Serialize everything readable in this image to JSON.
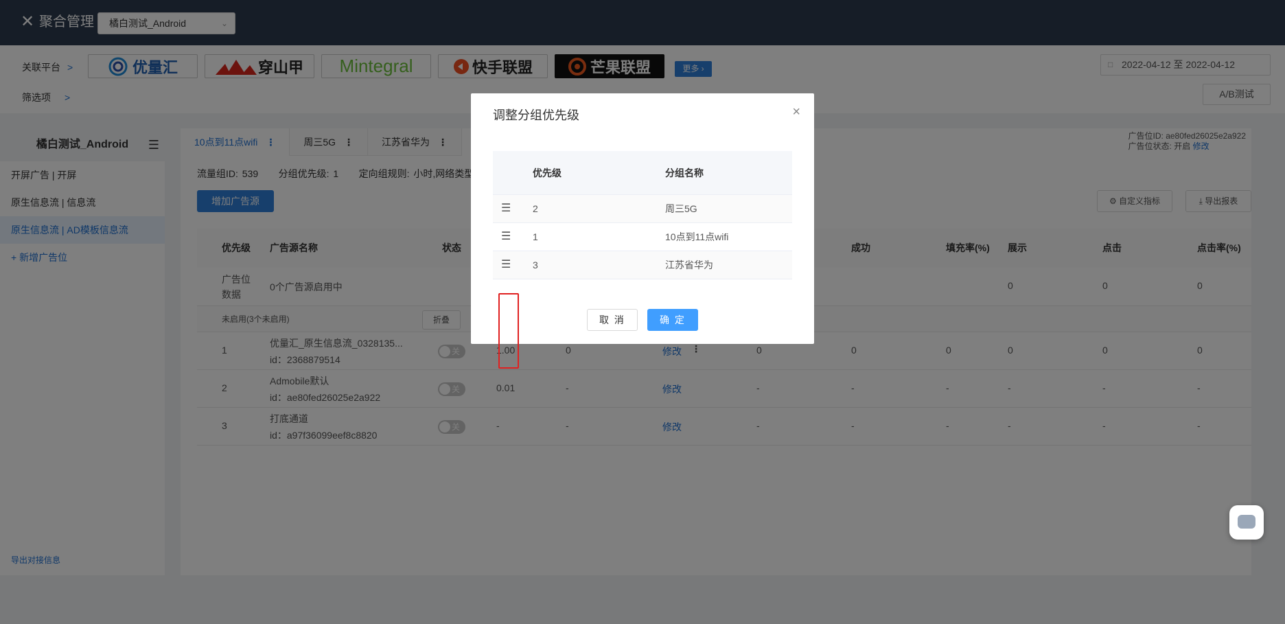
{
  "topbar": {
    "close": "✕",
    "title": "聚合管理",
    "app_select": "橘白测试_Android"
  },
  "platforms": {
    "label": "关联平台",
    "filter_label": "筛选项",
    "items": [
      "优量汇",
      "穿山甲",
      "Mintegral",
      "快手联盟",
      "芒果联盟"
    ],
    "more": "更多 ›",
    "date_start": "2022-04-12",
    "date_sep": "至",
    "date_end": "2022-04-12",
    "ab_test": "A/B测试"
  },
  "sidebar": {
    "title": "橘白测试_Android",
    "items": [
      "开屏广告 | 开屏",
      "原生信息流 | 信息流",
      "原生信息流 | AD模板信息流"
    ],
    "add": "+ 新增广告位",
    "export": "导出对接信息"
  },
  "main": {
    "tabs": [
      "10点到11点wifi",
      "周三5G",
      "江苏省华为"
    ],
    "ad_id_label": "广告位ID:",
    "ad_id": "ae80fed26025e2a922",
    "ad_status_label": "广告位状态:",
    "ad_status": "开启",
    "ad_status_edit": "修改",
    "flow_id": "流量组ID: 539",
    "group_priority": "分组优先级: 1",
    "targeting": "定向组规则: 小时,网络类型",
    "add_source": "增加广告源",
    "custom_metric": "⚙ 自定义指标",
    "export_report": "⤓ 导出报表",
    "headers": [
      "优先级",
      "广告源名称",
      "状态",
      "成功",
      "填充率(%)",
      "展示",
      "点击",
      "点击率(%)"
    ],
    "summary_label": "广告位数据",
    "summary_text": "0个广告源启用中",
    "summary_values": [
      "0",
      "0",
      "0"
    ],
    "disabled_text": "未启用(3个未启用)",
    "fold": "折叠",
    "toggle_off": "关",
    "edit": "修改",
    "rows": [
      {
        "priority": "1",
        "name": "优量汇_原生信息流_0328135...",
        "id": "id：2368879514",
        "price": "1.00",
        "c2": "0",
        "vals": [
          "0",
          "0",
          "0",
          "0",
          "0",
          "0"
        ]
      },
      {
        "priority": "2",
        "name": "Admobile默认",
        "id": "id：ae80fed26025e2a922",
        "price": "0.01",
        "c2": "-",
        "vals": [
          "-",
          "-",
          "-",
          "-",
          "-",
          "-"
        ]
      },
      {
        "priority": "3",
        "name": "打底通道",
        "id": "id：a97f36099eef8c8820",
        "price": "-",
        "c2": "-",
        "vals": [
          "-",
          "-",
          "-",
          "-",
          "-",
          "-"
        ]
      }
    ]
  },
  "modal": {
    "title": "调整分组优先级",
    "close": "×",
    "col_priority": "优先级",
    "col_name": "分组名称",
    "rows": [
      {
        "priority": "2",
        "name": "周三5G"
      },
      {
        "priority": "1",
        "name": "10点到11点wifi"
      },
      {
        "priority": "3",
        "name": "江苏省华为"
      }
    ],
    "cancel": "取 消",
    "confirm": "确 定"
  },
  "colors": {
    "accent": "#2f7fd8",
    "header_bg": "#2c3a4e",
    "confirm": "#409eff",
    "highlight": "#e02020"
  }
}
